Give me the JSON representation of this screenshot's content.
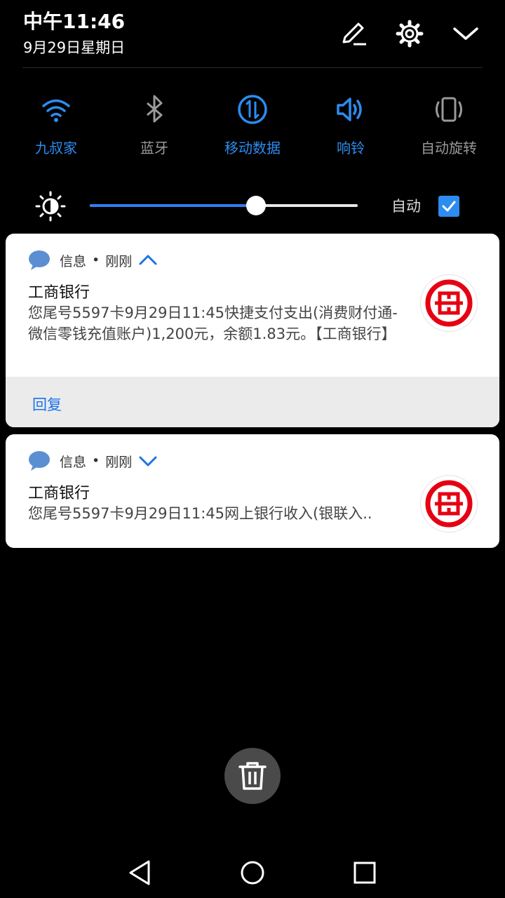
{
  "status": {
    "time": "中午11:46",
    "date": "9月29日星期日"
  },
  "header_icons": [
    "edit-icon",
    "settings-gear-icon",
    "collapse-chevron-icon"
  ],
  "quick_toggles": [
    {
      "label": "九叔家",
      "icon": "wifi-icon",
      "active": true
    },
    {
      "label": "蓝牙",
      "icon": "bluetooth-icon",
      "active": false
    },
    {
      "label": "移动数据",
      "icon": "mobile-data-icon",
      "active": true
    },
    {
      "label": "响铃",
      "icon": "ring-volume-icon",
      "active": true
    },
    {
      "label": "自动旋转",
      "icon": "auto-rotate-icon",
      "active": false
    }
  ],
  "brightness": {
    "level": 0.62,
    "auto_label": "自动",
    "auto_checked": true
  },
  "notifications": [
    {
      "app": "信息",
      "separator": "•",
      "time": "刚刚",
      "expanded": true,
      "sender": "工商银行",
      "message": "您尾号5597卡9月29日11:45快捷支付支出(消费财付通-微信零钱充值账户)1,200元，余额1.83元。【工商银行】",
      "action": "回复"
    },
    {
      "app": "信息",
      "separator": "•",
      "time": "刚刚",
      "expanded": false,
      "sender": "工商银行",
      "message": "您尾号5597卡9月29日11:45网上银行收入(银联入.."
    }
  ],
  "colors": {
    "accent": "#2d8cf0",
    "icbc_red": "#e60012",
    "inactive": "#9a9a9a"
  }
}
